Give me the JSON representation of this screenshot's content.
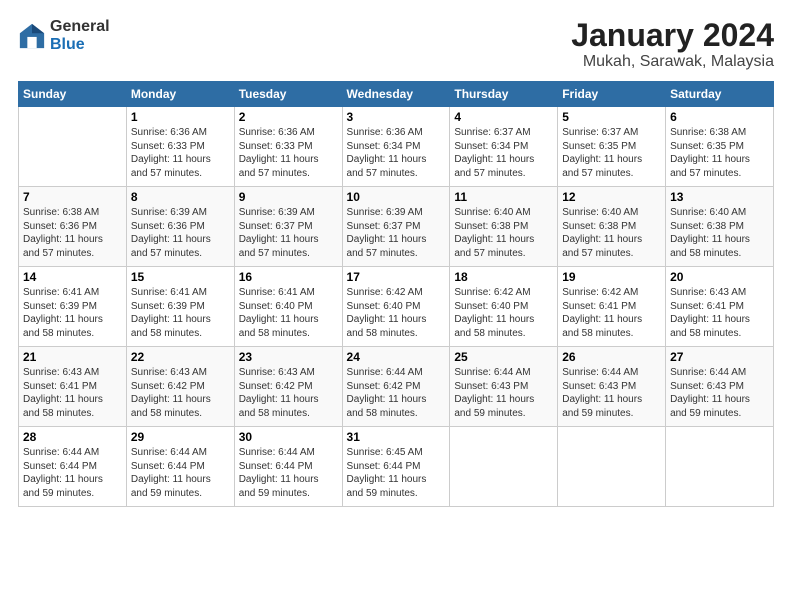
{
  "logo": {
    "general": "General",
    "blue": "Blue"
  },
  "title": "January 2024",
  "location": "Mukah, Sarawak, Malaysia",
  "days_of_week": [
    "Sunday",
    "Monday",
    "Tuesday",
    "Wednesday",
    "Thursday",
    "Friday",
    "Saturday"
  ],
  "weeks": [
    [
      {
        "day": "",
        "info": ""
      },
      {
        "day": "1",
        "sunrise": "6:36 AM",
        "sunset": "6:33 PM",
        "daylight": "11 hours and 57 minutes."
      },
      {
        "day": "2",
        "sunrise": "6:36 AM",
        "sunset": "6:33 PM",
        "daylight": "11 hours and 57 minutes."
      },
      {
        "day": "3",
        "sunrise": "6:36 AM",
        "sunset": "6:34 PM",
        "daylight": "11 hours and 57 minutes."
      },
      {
        "day": "4",
        "sunrise": "6:37 AM",
        "sunset": "6:34 PM",
        "daylight": "11 hours and 57 minutes."
      },
      {
        "day": "5",
        "sunrise": "6:37 AM",
        "sunset": "6:35 PM",
        "daylight": "11 hours and 57 minutes."
      },
      {
        "day": "6",
        "sunrise": "6:38 AM",
        "sunset": "6:35 PM",
        "daylight": "11 hours and 57 minutes."
      }
    ],
    [
      {
        "day": "7",
        "sunrise": "6:38 AM",
        "sunset": "6:36 PM",
        "daylight": "11 hours and 57 minutes."
      },
      {
        "day": "8",
        "sunrise": "6:39 AM",
        "sunset": "6:36 PM",
        "daylight": "11 hours and 57 minutes."
      },
      {
        "day": "9",
        "sunrise": "6:39 AM",
        "sunset": "6:37 PM",
        "daylight": "11 hours and 57 minutes."
      },
      {
        "day": "10",
        "sunrise": "6:39 AM",
        "sunset": "6:37 PM",
        "daylight": "11 hours and 57 minutes."
      },
      {
        "day": "11",
        "sunrise": "6:40 AM",
        "sunset": "6:38 PM",
        "daylight": "11 hours and 57 minutes."
      },
      {
        "day": "12",
        "sunrise": "6:40 AM",
        "sunset": "6:38 PM",
        "daylight": "11 hours and 57 minutes."
      },
      {
        "day": "13",
        "sunrise": "6:40 AM",
        "sunset": "6:38 PM",
        "daylight": "11 hours and 58 minutes."
      }
    ],
    [
      {
        "day": "14",
        "sunrise": "6:41 AM",
        "sunset": "6:39 PM",
        "daylight": "11 hours and 58 minutes."
      },
      {
        "day": "15",
        "sunrise": "6:41 AM",
        "sunset": "6:39 PM",
        "daylight": "11 hours and 58 minutes."
      },
      {
        "day": "16",
        "sunrise": "6:41 AM",
        "sunset": "6:40 PM",
        "daylight": "11 hours and 58 minutes."
      },
      {
        "day": "17",
        "sunrise": "6:42 AM",
        "sunset": "6:40 PM",
        "daylight": "11 hours and 58 minutes."
      },
      {
        "day": "18",
        "sunrise": "6:42 AM",
        "sunset": "6:40 PM",
        "daylight": "11 hours and 58 minutes."
      },
      {
        "day": "19",
        "sunrise": "6:42 AM",
        "sunset": "6:41 PM",
        "daylight": "11 hours and 58 minutes."
      },
      {
        "day": "20",
        "sunrise": "6:43 AM",
        "sunset": "6:41 PM",
        "daylight": "11 hours and 58 minutes."
      }
    ],
    [
      {
        "day": "21",
        "sunrise": "6:43 AM",
        "sunset": "6:41 PM",
        "daylight": "11 hours and 58 minutes."
      },
      {
        "day": "22",
        "sunrise": "6:43 AM",
        "sunset": "6:42 PM",
        "daylight": "11 hours and 58 minutes."
      },
      {
        "day": "23",
        "sunrise": "6:43 AM",
        "sunset": "6:42 PM",
        "daylight": "11 hours and 58 minutes."
      },
      {
        "day": "24",
        "sunrise": "6:44 AM",
        "sunset": "6:42 PM",
        "daylight": "11 hours and 58 minutes."
      },
      {
        "day": "25",
        "sunrise": "6:44 AM",
        "sunset": "6:43 PM",
        "daylight": "11 hours and 59 minutes."
      },
      {
        "day": "26",
        "sunrise": "6:44 AM",
        "sunset": "6:43 PM",
        "daylight": "11 hours and 59 minutes."
      },
      {
        "day": "27",
        "sunrise": "6:44 AM",
        "sunset": "6:43 PM",
        "daylight": "11 hours and 59 minutes."
      }
    ],
    [
      {
        "day": "28",
        "sunrise": "6:44 AM",
        "sunset": "6:44 PM",
        "daylight": "11 hours and 59 minutes."
      },
      {
        "day": "29",
        "sunrise": "6:44 AM",
        "sunset": "6:44 PM",
        "daylight": "11 hours and 59 minutes."
      },
      {
        "day": "30",
        "sunrise": "6:44 AM",
        "sunset": "6:44 PM",
        "daylight": "11 hours and 59 minutes."
      },
      {
        "day": "31",
        "sunrise": "6:45 AM",
        "sunset": "6:44 PM",
        "daylight": "11 hours and 59 minutes."
      },
      {
        "day": "",
        "info": ""
      },
      {
        "day": "",
        "info": ""
      },
      {
        "day": "",
        "info": ""
      }
    ]
  ],
  "labels": {
    "sunrise": "Sunrise:",
    "sunset": "Sunset:",
    "daylight": "Daylight:"
  }
}
